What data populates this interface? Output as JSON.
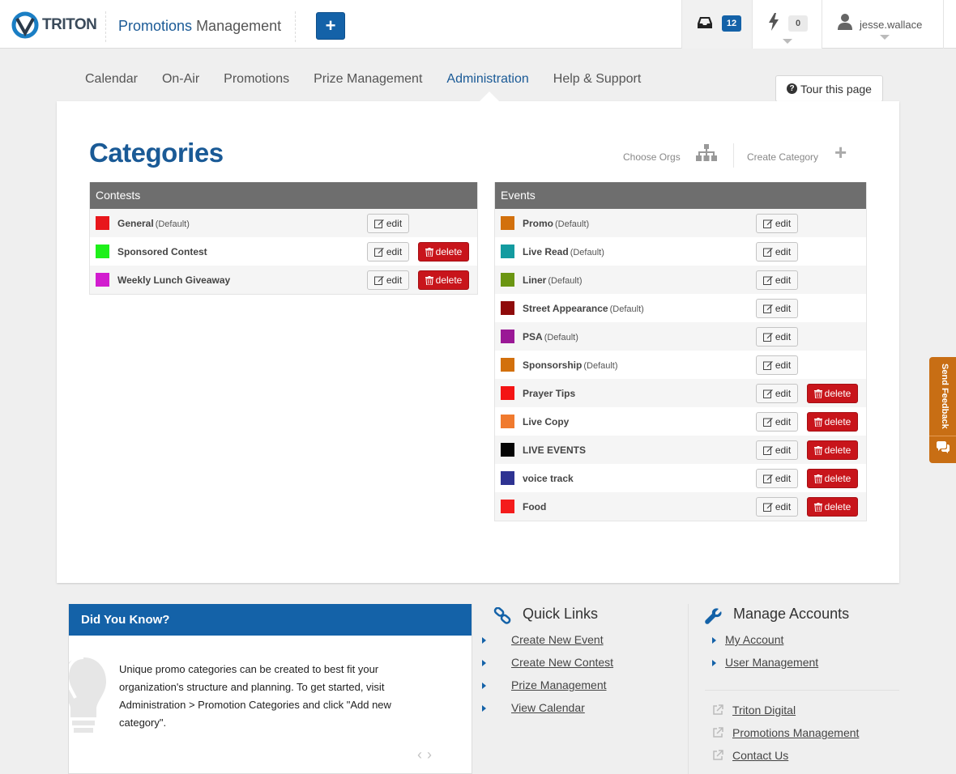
{
  "header": {
    "logo_text": "TRITON",
    "app_title_highlight": "Promotions",
    "app_title_rest": "Management",
    "add_button": "+",
    "inbox_count": "12",
    "alerts_count": "0",
    "username": "jesse.wallace"
  },
  "nav": {
    "items": [
      {
        "label": "Calendar",
        "active": false
      },
      {
        "label": "On-Air",
        "active": false
      },
      {
        "label": "Promotions",
        "active": false
      },
      {
        "label": "Prize Management",
        "active": false
      },
      {
        "label": "Administration",
        "active": true
      },
      {
        "label": "Help & Support",
        "active": false
      }
    ],
    "tour_button": "Tour this page"
  },
  "page": {
    "title": "Categories",
    "choose_orgs": "Choose Orgs",
    "create_category": "Create Category"
  },
  "buttons": {
    "edit": "edit",
    "delete": "delete"
  },
  "contests": {
    "heading": "Contests",
    "rows": [
      {
        "name": "General",
        "suffix": "(Default)",
        "color": "#e8161b",
        "deletable": false
      },
      {
        "name": "Sponsored Contest",
        "suffix": "",
        "color": "#1ef01a",
        "deletable": true
      },
      {
        "name": "Weekly Lunch Giveaway",
        "suffix": "",
        "color": "#d21ccf",
        "deletable": true
      }
    ]
  },
  "events": {
    "heading": "Events",
    "rows": [
      {
        "name": "Promo",
        "suffix": "(Default)",
        "color": "#d2700c",
        "deletable": false
      },
      {
        "name": "Live Read",
        "suffix": "(Default)",
        "color": "#139ba0",
        "deletable": false
      },
      {
        "name": "Liner",
        "suffix": "(Default)",
        "color": "#6b9612",
        "deletable": false
      },
      {
        "name": "Street Appearance",
        "suffix": "(Default)",
        "color": "#8f0b0b",
        "deletable": false
      },
      {
        "name": "PSA",
        "suffix": "(Default)",
        "color": "#9a1896",
        "deletable": false
      },
      {
        "name": "Sponsorship",
        "suffix": "(Default)",
        "color": "#d2700c",
        "deletable": false
      },
      {
        "name": "Prayer Tips",
        "suffix": "",
        "color": "#f41414",
        "deletable": true
      },
      {
        "name": "Live Copy",
        "suffix": "",
        "color": "#f07a2e",
        "deletable": true
      },
      {
        "name": "LIVE EVENTS",
        "suffix": "",
        "color": "#050505",
        "deletable": true
      },
      {
        "name": "voice track",
        "suffix": "",
        "color": "#2e3392",
        "deletable": true
      },
      {
        "name": "Food",
        "suffix": "",
        "color": "#f41c1c",
        "deletable": true
      }
    ]
  },
  "did_you_know": {
    "heading": "Did You Know?",
    "text": "Unique promo categories can be created to best fit your organization's structure and planning. To get started, visit Administration > Promotion Categories and click \"Add new category\"."
  },
  "quick_links": {
    "heading": "Quick Links",
    "items": [
      "Create New Event",
      "Create New Contest",
      "Prize Management",
      "View Calendar"
    ]
  },
  "manage_accounts": {
    "heading": "Manage Accounts",
    "items": [
      "My Account",
      "User Management"
    ],
    "external": [
      "Triton Digital",
      "Promotions Management",
      "Contact Us"
    ]
  },
  "feedback": {
    "label": "Send Feedback"
  },
  "colors": {
    "brand_blue": "#1462a8",
    "danger_red": "#c8151b",
    "feedback_orange": "#c86e14"
  }
}
